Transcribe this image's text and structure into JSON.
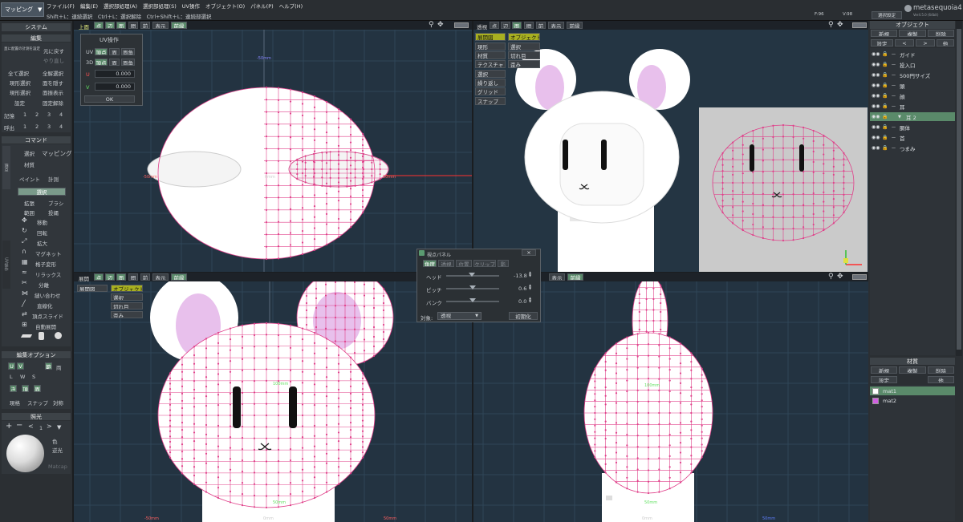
{
  "menubar": {
    "mode": "マッピング",
    "menus": [
      "ファイル(F)",
      "編集(E)",
      "選択部処理(A)",
      "選択部処理(S)",
      "UV操作",
      "オブジェクト(O)",
      "パネル(P)",
      "ヘルプ(H)"
    ],
    "hint": "Shift＋L：連続選択　Ctrl＋L：選択解除　Ctrl+Shift＋L：連続部選択",
    "f_label": "F:96",
    "v_label": "V:98",
    "select_settings": "選択設定",
    "logo": "metasequoia4",
    "version": "Ver4.5.0 (64bit)"
  },
  "left": {
    "system": "システム",
    "edit": "編集",
    "edit_rows": [
      [
        "直に配置の計測を設定",
        "元に戻す"
      ],
      [
        "",
        "やり直し"
      ],
      [
        "全て選択",
        "全解選択"
      ],
      [
        "現形選択",
        "面を隠す"
      ],
      [
        "現形選択",
        "面振表示"
      ],
      [
        "設定",
        "固定解除"
      ]
    ],
    "memory_label": "記憶",
    "memory": [
      "1",
      "2",
      "3",
      "4"
    ],
    "restore_label": "呼出",
    "command": "コマンド",
    "select_tab": "選択",
    "mapping_tab": "マッピング",
    "material_tab": "材質",
    "paint_tab": "ペイント",
    "measure_tab": "計測",
    "select_btn": "選択",
    "expand": "拡張",
    "brush": "ブラシ",
    "range": "範囲",
    "lasso": "投縄",
    "tools": [
      "移動",
      "回転",
      "拡大",
      "マグネット",
      "格子変形",
      "リラックス",
      "分離",
      "縫い合わせ",
      "直線化",
      "頂点スライド",
      "自動展開"
    ],
    "edit_option": "編集オプション",
    "opt_labels": [
      "U",
      "V",
      "範",
      "両"
    ],
    "opt_row2": [
      "L",
      "W",
      "S"
    ],
    "opt_row3": [
      "き",
      "頂",
      "面"
    ],
    "opt_row4": [
      "現格",
      "スナップ",
      "対称"
    ],
    "light": "照光",
    "light_num": "1",
    "light_opts": [
      "色",
      "逆光"
    ],
    "matcap": "Matcap",
    "side_labels": [
      "頂点",
      "UV操作"
    ]
  },
  "uvpanel": {
    "title": "UV操作",
    "uv": "UV",
    "uv_btns": [
      "頂点",
      "面",
      "面角"
    ],
    "d3": "3D",
    "d3_btns": [
      "頂点",
      "面",
      "面角"
    ],
    "u": "U",
    "u_val": "0.000",
    "v": "V",
    "v_val": "0.000",
    "ok": "OK"
  },
  "viewport_tl": {
    "label": "上面",
    "toolbar": [
      "点",
      "辺",
      "面",
      "間",
      "前",
      "表示",
      "前縁"
    ],
    "ruler": [
      "-50mm",
      "0mm",
      "50mm",
      "-50mm"
    ]
  },
  "viewport_tr": {
    "label": "透視",
    "toolbar": [
      "点",
      "辺",
      "面",
      "間",
      "前",
      "表示",
      "前縁"
    ],
    "menu": [
      "展開図",
      "現形",
      "材質",
      "テクスチャ",
      "選択",
      "繰り返し",
      "グリッド",
      "スナップ"
    ],
    "menu2": [
      "オブジェクト",
      "選択",
      "切れ目",
      "歪み"
    ]
  },
  "viewport_bl": {
    "label": "展開",
    "toolbar": [
      "点",
      "辺",
      "面",
      "間",
      "前",
      "表示",
      "前縁"
    ],
    "menu": [
      "展開図"
    ],
    "menu2": [
      "オブジェクト",
      "選択",
      "切れ目",
      "歪み"
    ],
    "ruler": [
      "100mm",
      "50mm",
      "0mm",
      "-50mm",
      "50mm"
    ]
  },
  "viewport_br": {
    "toolbar": [
      "点",
      "辺",
      "面",
      "表示",
      "前縁"
    ],
    "ruler": [
      "100mm",
      "50mm",
      "0mm",
      "50mm"
    ]
  },
  "camera": {
    "title": "視点パネル",
    "tabs": [
      "角度",
      "透視",
      "位置",
      "クリップ",
      "影"
    ],
    "head": "ヘッド",
    "head_val": "-13.8",
    "pitch": "ピッチ",
    "pitch_val": "0.6",
    "bank": "バンク",
    "bank_val": "0.0",
    "target_label": "対象:",
    "target": "透視",
    "init": "初期化",
    "head_frac": 0.48,
    "pitch_frac": 0.5,
    "bank_frac": 0.5
  },
  "objects": {
    "title": "オブジェクト",
    "btns1": [
      "新規",
      "複製",
      "削除"
    ],
    "btns2": [
      "設定",
      "<",
      ">",
      "他"
    ],
    "items": [
      {
        "name": "ガイド",
        "indent": 0
      },
      {
        "name": "投入口",
        "indent": 0
      },
      {
        "name": "500円サイズ",
        "indent": 0
      },
      {
        "name": "頭",
        "indent": 0
      },
      {
        "name": "顔",
        "indent": 0
      },
      {
        "name": "耳",
        "indent": 0
      },
      {
        "name": "耳 2",
        "indent": 1,
        "selected": true
      },
      {
        "name": "胴体",
        "indent": 0
      },
      {
        "name": "首",
        "indent": 0
      },
      {
        "name": "つまみ",
        "indent": 0
      }
    ]
  },
  "materials": {
    "title": "材質",
    "btns1": [
      "新規",
      "複製",
      "削除"
    ],
    "btns2": [
      "設定",
      "他"
    ],
    "items": [
      {
        "name": "mat1",
        "color": "#ffffff",
        "selected": true
      },
      {
        "name": "mat2",
        "color": "#d060e0"
      }
    ]
  },
  "colors": {
    "accent": "#5a8a6a",
    "mesh": "#e0408a",
    "grid": "#2f4658",
    "body": "#ffffff",
    "ear": "#e8c0ec"
  }
}
